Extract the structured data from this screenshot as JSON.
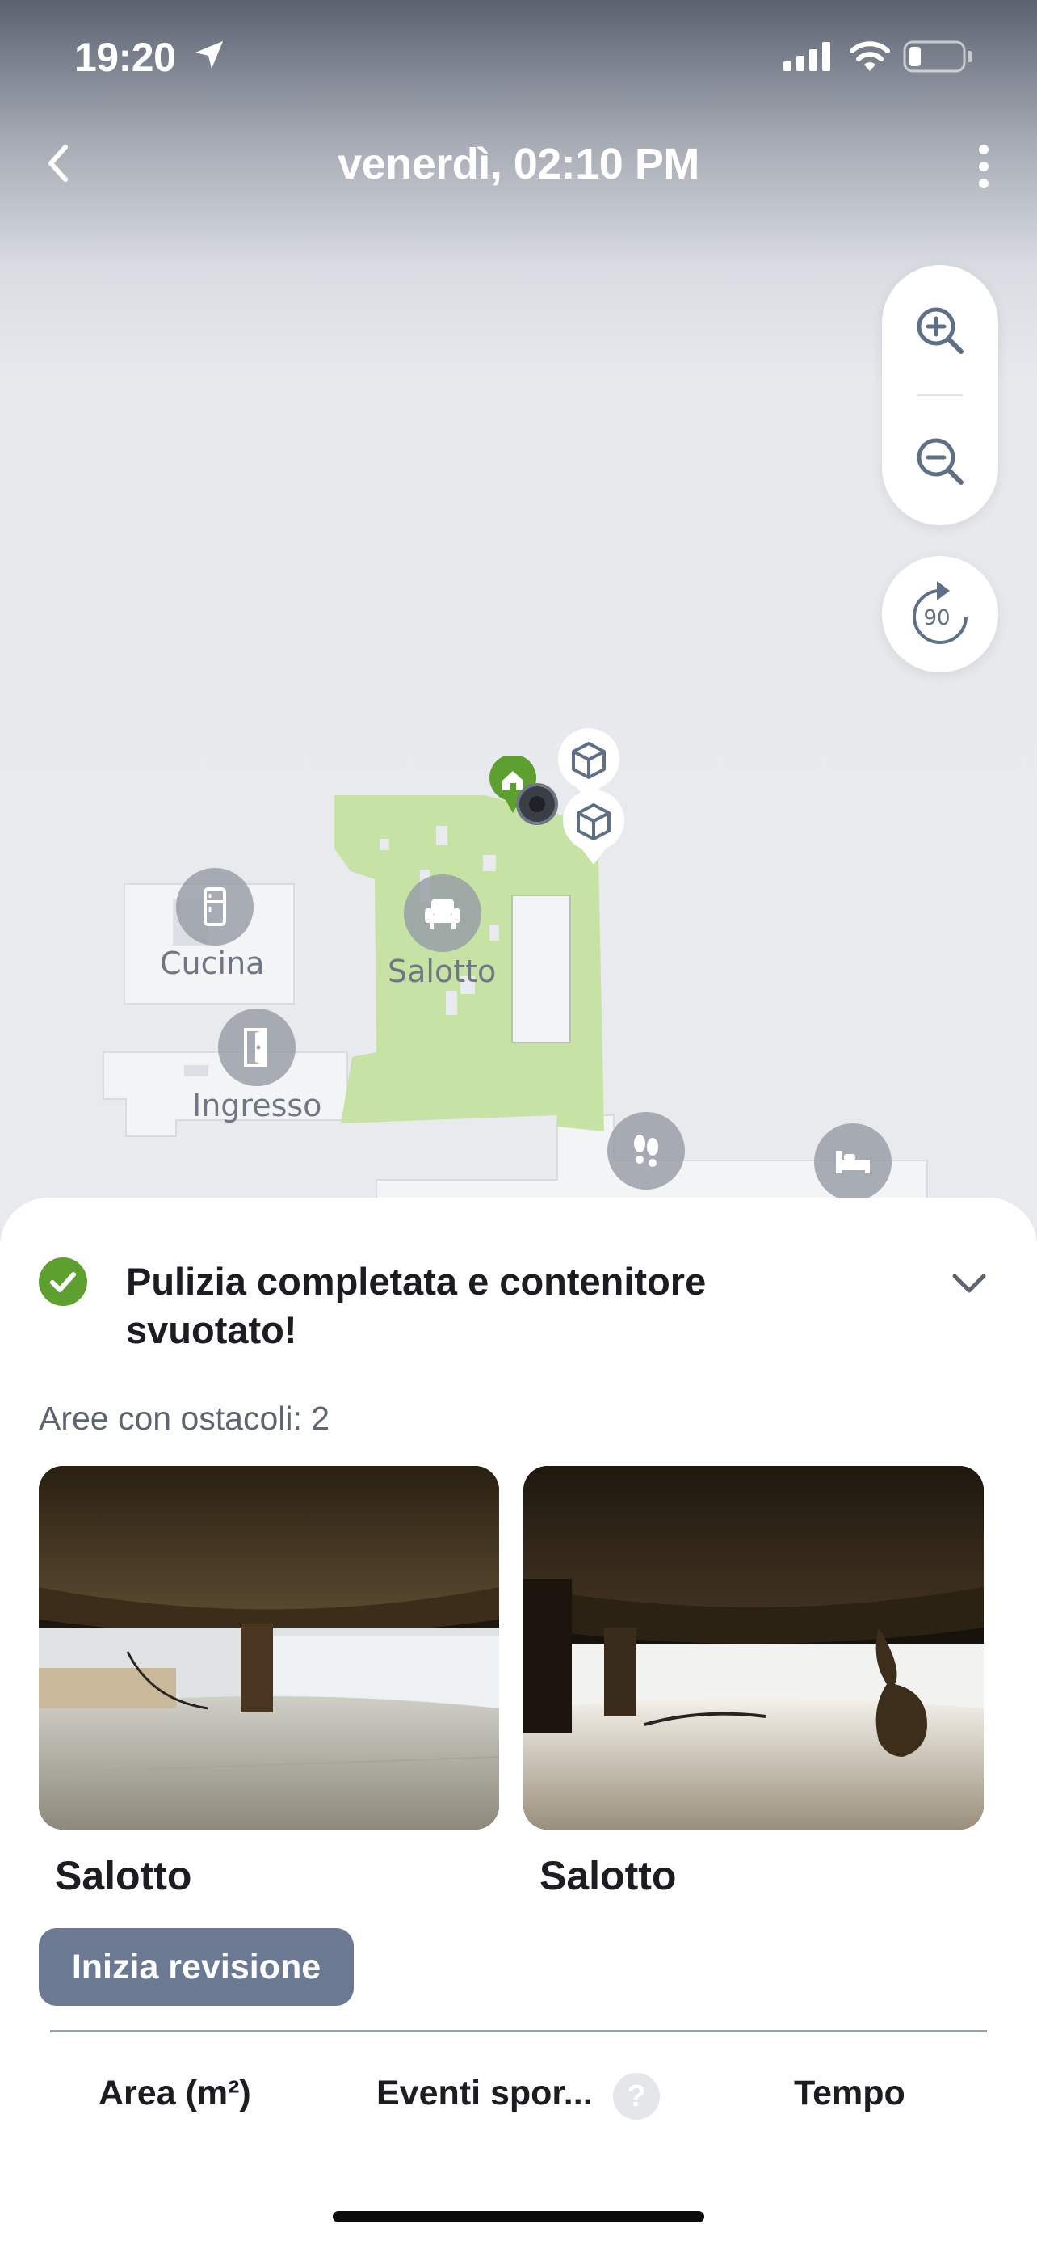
{
  "status_bar": {
    "time": "19:20",
    "location_icon": "location-arrow-icon",
    "signal_icon": "cellular-signal-icon",
    "wifi_icon": "wifi-icon",
    "battery_icon": "battery-low-icon"
  },
  "header": {
    "title": "venerdì, 02:10 PM",
    "back_icon": "chevron-left-icon",
    "more_icon": "vertical-ellipsis-icon"
  },
  "map_controls": {
    "zoom_in_icon": "zoom-in-icon",
    "zoom_out_icon": "zoom-out-icon",
    "rotate_label": "90",
    "rotate_icon": "rotate-icon"
  },
  "map": {
    "rooms": [
      {
        "label": "Cucina",
        "icon": "fridge-icon"
      },
      {
        "label": "Ingresso",
        "icon": "door-icon"
      },
      {
        "label": "Salotto",
        "icon": "armchair-icon"
      }
    ],
    "markers": [
      "home-base-icon",
      "robot-icon",
      "obstacle-box-icon",
      "obstacle-box-icon",
      "footprints-icon",
      "bed-icon"
    ],
    "cleaned_color": "#c6e3a5",
    "accent_green": "#5ea02f"
  },
  "summary": {
    "title": "Pulizia completata e contenitore svuotato!",
    "obstacles_label": "Aree con ostacoli: 2",
    "photos": [
      {
        "caption": "Salotto"
      },
      {
        "caption": "Salotto"
      }
    ],
    "review_button": "Inizia revisione",
    "stats": {
      "area_label": "Area (m²)",
      "events_label": "Eventi spor...",
      "time_label": "Tempo"
    }
  }
}
